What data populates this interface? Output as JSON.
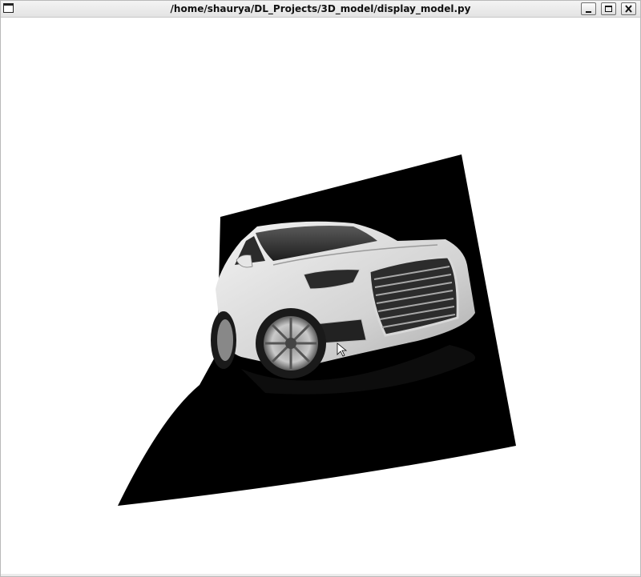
{
  "window": {
    "title": "/home/shaurya/DL_Projects/3D_model/display_model.py"
  },
  "icons": {
    "app": "window-icon",
    "minimize": "minimize-icon",
    "maximize": "maximize-icon",
    "close": "close-icon",
    "pointer": "mouse-pointer-icon"
  },
  "colors": {
    "background": "#ffffff",
    "quad": "#000000",
    "car_body": "#d9d9d9"
  }
}
